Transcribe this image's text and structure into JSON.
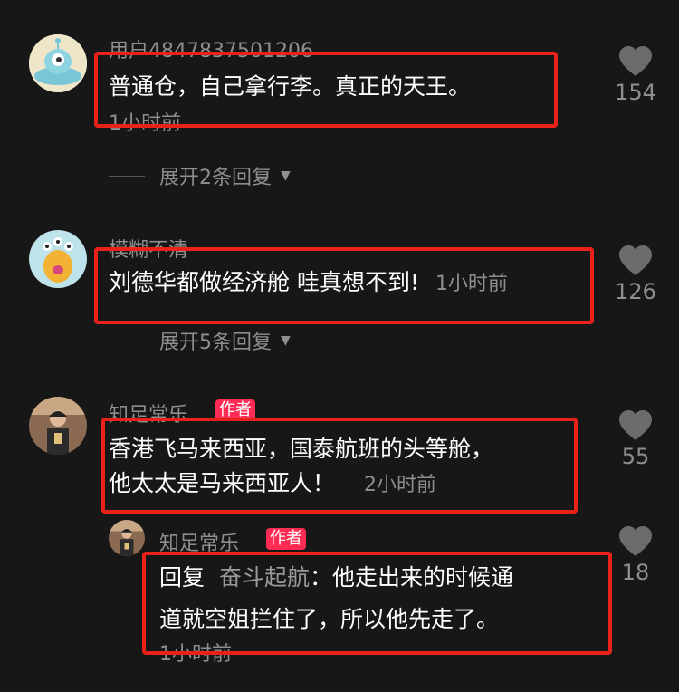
{
  "comments": [
    {
      "username": "用户4847837501206",
      "text": "普通仓，自己拿行李。真正的天王。",
      "time": "1小时前",
      "likes": "154",
      "expand": "展开2条回复"
    },
    {
      "username": "模糊不清",
      "text": "刘德华都做经济舱 哇真想不到!",
      "time": "1小时前",
      "likes": "126",
      "expand": "展开5条回复"
    },
    {
      "username": "知足常乐",
      "badge": "作者",
      "text_line1": "香港飞马来西亚，国泰航班的头等舱，",
      "text_line2": "他太太是马来西亚人！",
      "time": "2小时前",
      "likes": "55"
    }
  ],
  "reply": {
    "username": "知足常乐",
    "badge": "作者",
    "prefix": "回复",
    "reply_to": "奋斗起航",
    "text_line1": "：他走出来的时候通",
    "text_line2": "道就空姐拦住了，所以他先走了。",
    "time": "1小时前",
    "likes": "18"
  },
  "icons": {
    "like": "heart-icon",
    "expand": "chevron-down-icon"
  },
  "colors": {
    "background": "#171717",
    "highlight": "#e8221b",
    "badge": "#fe2c55",
    "muted_text": "#8e8e8e"
  }
}
